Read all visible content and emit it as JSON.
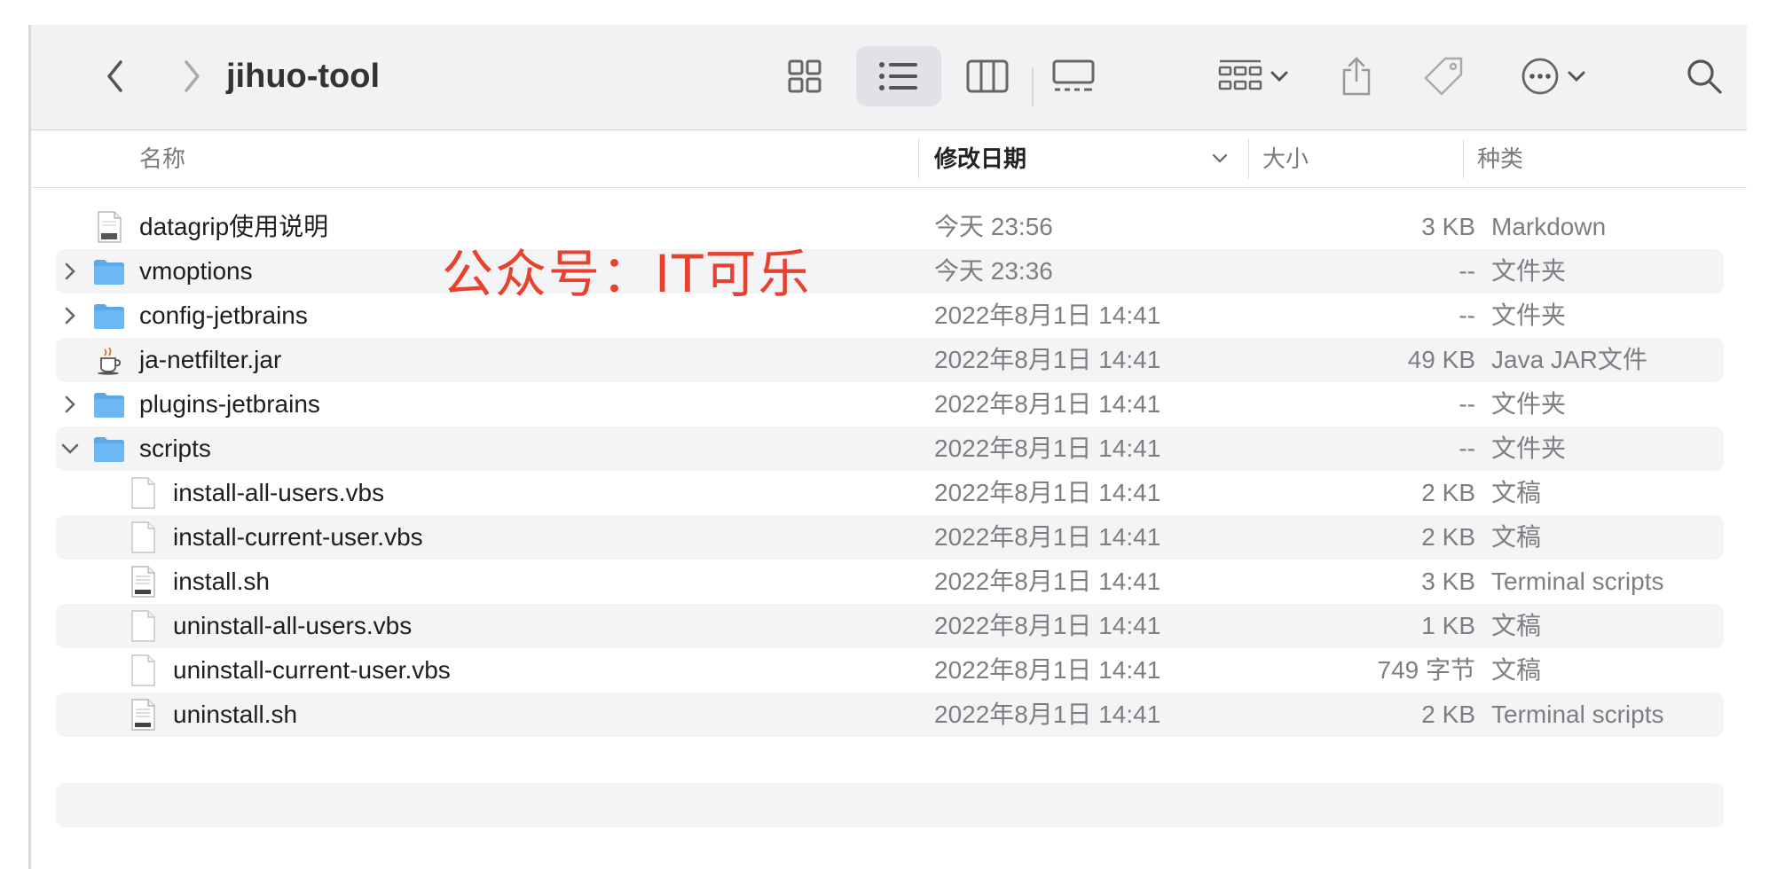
{
  "window": {
    "title": "jihuo-tool"
  },
  "header": {
    "name": "名称",
    "date": "修改日期",
    "size": "大小",
    "kind": "种类"
  },
  "watermark": "公众号：IT可乐",
  "rows": [
    {
      "name": "datagrip使用说明",
      "date": "今天 23:56",
      "size": "3 KB",
      "kind": "Markdown",
      "icon": "markdown-file-icon",
      "disc": ""
    },
    {
      "name": "vmoptions",
      "date": "今天 23:36",
      "size": "--",
      "kind": "文件夹",
      "icon": "folder-icon",
      "disc": "collapsed"
    },
    {
      "name": "config-jetbrains",
      "date": "2022年8月1日 14:41",
      "size": "--",
      "kind": "文件夹",
      "icon": "folder-icon",
      "disc": "collapsed"
    },
    {
      "name": "ja-netfilter.jar",
      "date": "2022年8月1日 14:41",
      "size": "49 KB",
      "kind": "Java JAR文件",
      "icon": "java-jar-icon",
      "disc": ""
    },
    {
      "name": "plugins-jetbrains",
      "date": "2022年8月1日 14:41",
      "size": "--",
      "kind": "文件夹",
      "icon": "folder-icon",
      "disc": "collapsed"
    },
    {
      "name": "scripts",
      "date": "2022年8月1日 14:41",
      "size": "--",
      "kind": "文件夹",
      "icon": "folder-icon",
      "disc": "expanded"
    },
    {
      "name": "install-all-users.vbs",
      "date": "2022年8月1日 14:41",
      "size": "2 KB",
      "kind": "文稿",
      "icon": "document-icon",
      "disc": "",
      "indent": 1
    },
    {
      "name": "install-current-user.vbs",
      "date": "2022年8月1日 14:41",
      "size": "2 KB",
      "kind": "文稿",
      "icon": "document-icon",
      "disc": "",
      "indent": 1
    },
    {
      "name": "install.sh",
      "date": "2022年8月1日 14:41",
      "size": "3 KB",
      "kind": "Terminal scripts",
      "icon": "shell-script-icon",
      "disc": "",
      "indent": 1
    },
    {
      "name": "uninstall-all-users.vbs",
      "date": "2022年8月1日 14:41",
      "size": "1 KB",
      "kind": "文稿",
      "icon": "document-icon",
      "disc": "",
      "indent": 1
    },
    {
      "name": "uninstall-current-user.vbs",
      "date": "2022年8月1日 14:41",
      "size": "749 字节",
      "kind": "文稿",
      "icon": "document-icon",
      "disc": "",
      "indent": 1
    },
    {
      "name": "uninstall.sh",
      "date": "2022年8月1日 14:41",
      "size": "2 KB",
      "kind": "Terminal scripts",
      "icon": "shell-script-icon",
      "disc": "",
      "indent": 1
    }
  ],
  "colors": {
    "folder": "#5aa9ea",
    "watermark": "#e8412d",
    "toolbar_bg": "#f2f2f5",
    "stripe": "#f4f4f6"
  }
}
